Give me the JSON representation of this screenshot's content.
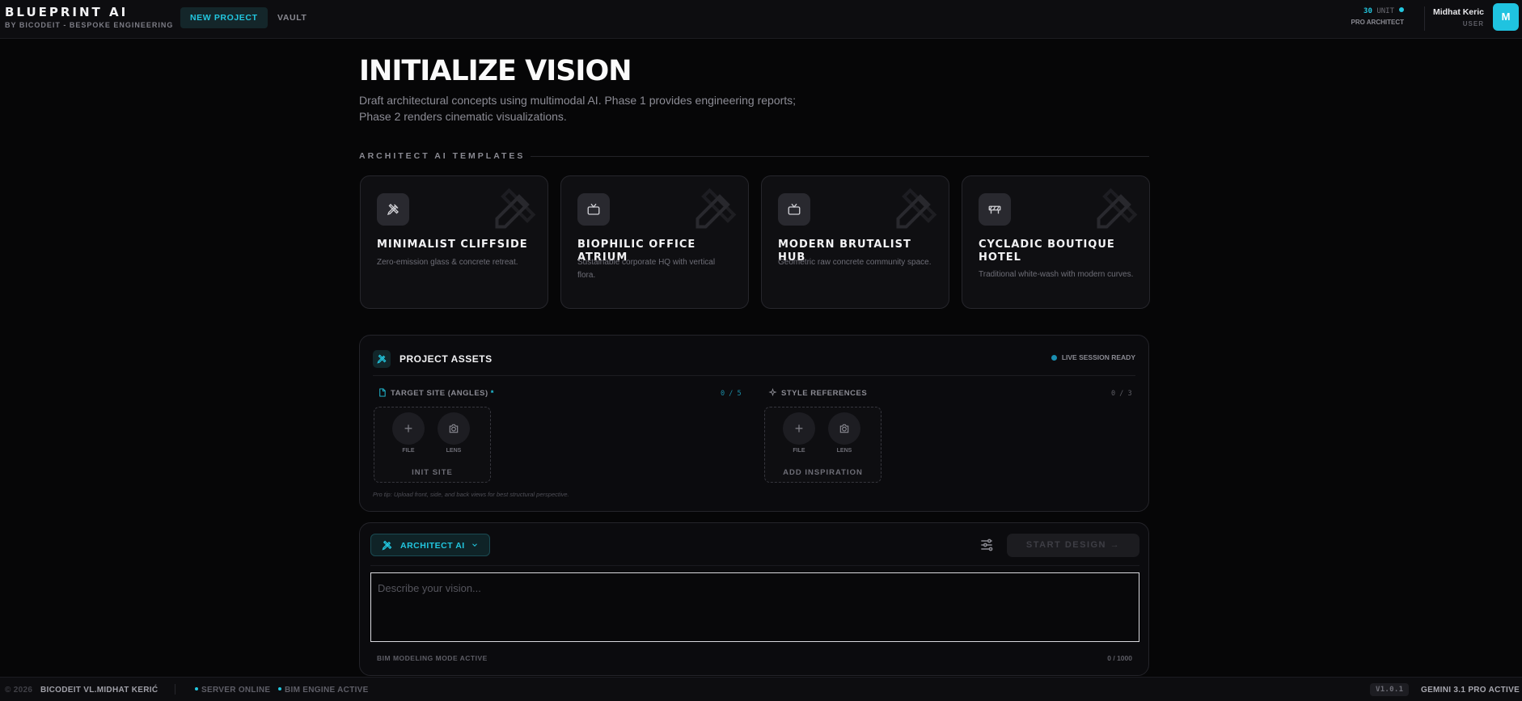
{
  "app": {
    "title": "BLUEPRINT AI",
    "subtitle": "BY BICODEIT - BESPOKE ENGINEERING"
  },
  "nav": {
    "tabs": [
      {
        "label": "NEW PROJECT",
        "active": true
      },
      {
        "label": "VAULT",
        "active": false
      }
    ]
  },
  "credits": {
    "amount": "30",
    "unit": "UNIT",
    "tier": "PRO ARCHITECT"
  },
  "user": {
    "name": "Midhat Keric",
    "role": "USER",
    "initial": "M"
  },
  "hero": {
    "title": "INITIALIZE VISION",
    "subtitle_line1": "Draft architectural concepts using multimodal AI. Phase 1 provides engineering reports;",
    "subtitle_line2": "Phase 2 renders cinematic visualizations."
  },
  "templates": {
    "section_label": "ARCHITECT AI TEMPLATES",
    "items": [
      {
        "name": "MINIMALIST CLIFFSIDE",
        "description": "Zero-emission glass & concrete retreat.",
        "icon": "pencil-ruler-icon"
      },
      {
        "name": "BIOPHILIC OFFICE ATRIUM",
        "description": "Sustainable corporate HQ with vertical flora.",
        "icon": "tv-icon"
      },
      {
        "name": "MODERN BRUTALIST HUB",
        "description": "Geometric raw concrete community space.",
        "icon": "tv-icon"
      },
      {
        "name": "CYCLADIC BOUTIQUE HOTEL",
        "description": "Traditional white-wash with modern curves.",
        "icon": "construction-barrier-icon"
      }
    ]
  },
  "assets": {
    "title": "PROJECT ASSETS",
    "status": "LIVE SESSION READY",
    "target_site": {
      "label": "TARGET SITE (ANGLES)",
      "required_mark": "*",
      "count": "0 / 5",
      "file_label": "FILE",
      "lens_label": "LENS",
      "zone_label": "INIT SITE"
    },
    "style_refs": {
      "label": "STYLE REFERENCES",
      "count": "0 / 3",
      "file_label": "FILE",
      "lens_label": "LENS",
      "zone_label": "ADD INSPIRATION"
    },
    "pro_tip": "Pro tip: Upload front, side, and back views for best structural perspective."
  },
  "prompt": {
    "model_label": "ARCHITECT AI",
    "start_label": "START DESIGN",
    "placeholder": "Describe your vision...",
    "value": "",
    "mode_label": "BIM MODELING MODE ACTIVE",
    "char_count": "0 / 1000"
  },
  "footer": {
    "copyright": "© 2026",
    "brand": "BICODEIT VL.MIDHAT KERIĆ",
    "status_server": "SERVER ONLINE",
    "status_engine": "BIM ENGINE ACTIVE",
    "version": "V1.0.1",
    "engine": "GEMINI 3.1 PRO ACTIVE"
  },
  "colors": {
    "accent": "#22c7e0",
    "background": "#060607",
    "panel": "#0b0b0e",
    "border": "#24242a"
  }
}
